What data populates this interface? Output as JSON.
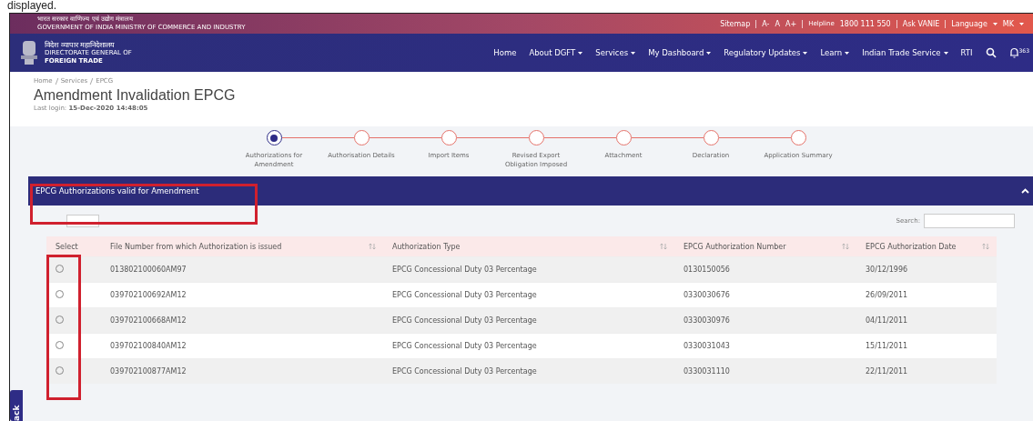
{
  "caption": "displayed.",
  "gov_bar": {
    "hindi": "भारत सरकार   वाणिज्य एवं उद्योग मंत्रालय",
    "english": "GOVERNMENT OF INDIA   MINISTRY OF COMMERCE AND INDUSTRY",
    "links": [
      {
        "label": "Sitemap"
      },
      {
        "label": "A-"
      },
      {
        "label": "A"
      },
      {
        "label": "A+"
      }
    ],
    "helpline_label": "Helpline",
    "helpline": "1800 111 550",
    "ask": "Ask VANIE",
    "language": "Language",
    "user": "MK"
  },
  "brand": {
    "hindi": "विदेश व्यापार महानिदेशालय",
    "line1": "DIRECTORATE GENERAL OF",
    "line2": "FOREIGN TRADE"
  },
  "nav": [
    {
      "label": "Home",
      "dropdown": false
    },
    {
      "label": "About DGFT",
      "dropdown": true
    },
    {
      "label": "Services",
      "dropdown": true
    },
    {
      "label": "My Dashboard",
      "dropdown": true
    },
    {
      "label": "Regulatory Updates",
      "dropdown": true
    },
    {
      "label": "Learn",
      "dropdown": true
    },
    {
      "label": "Indian Trade Service",
      "dropdown": true
    },
    {
      "label": "RTI",
      "dropdown": false
    }
  ],
  "notification_count": "363",
  "breadcrumb": [
    "Home",
    "Services",
    "EPCG"
  ],
  "title": "Amendment Invalidation EPCG",
  "last_login_label": "Last login:",
  "last_login": "15-Dec-2020 14:48:05",
  "steps": [
    {
      "label": "Authorizations for Amendment",
      "selected": true
    },
    {
      "label": "Authorisation Details",
      "selected": false
    },
    {
      "label": "Import Items",
      "selected": false
    },
    {
      "label": "Revised Export Obligation Imposed",
      "selected": false
    },
    {
      "label": "Attachment",
      "selected": false
    },
    {
      "label": "Declaration",
      "selected": false
    },
    {
      "label": "Application Summary",
      "selected": false
    }
  ],
  "section": {
    "title": "EPCG Authorizations valid for Amendment",
    "expanded": true
  },
  "search_label": "Search:",
  "table": {
    "columns": [
      "Select",
      "File Number from which Authorization is issued",
      "Authorization Type",
      "EPCG Authorization Number",
      "EPCG Authorization Date"
    ],
    "rows": [
      {
        "selected": false,
        "file": "013802100060AM97",
        "type": "EPCG Concessional Duty 03 Percentage",
        "number": "0130150056",
        "date": "30/12/1996"
      },
      {
        "selected": false,
        "file": "039702100692AM12",
        "type": "EPCG Concessional Duty 03 Percentage",
        "number": "0330030676",
        "date": "26/09/2011"
      },
      {
        "selected": false,
        "file": "039702100668AM12",
        "type": "EPCG Concessional Duty 03 Percentage",
        "number": "0330030976",
        "date": "04/11/2011"
      },
      {
        "selected": false,
        "file": "039702100840AM12",
        "type": "EPCG Concessional Duty 03 Percentage",
        "number": "0330031043",
        "date": "15/11/2011"
      },
      {
        "selected": false,
        "file": "039702100877AM12",
        "type": "EPCG Concessional Duty 03 Percentage",
        "number": "0330031110",
        "date": "22/11/2011"
      }
    ]
  },
  "feedback_tab": "ack"
}
